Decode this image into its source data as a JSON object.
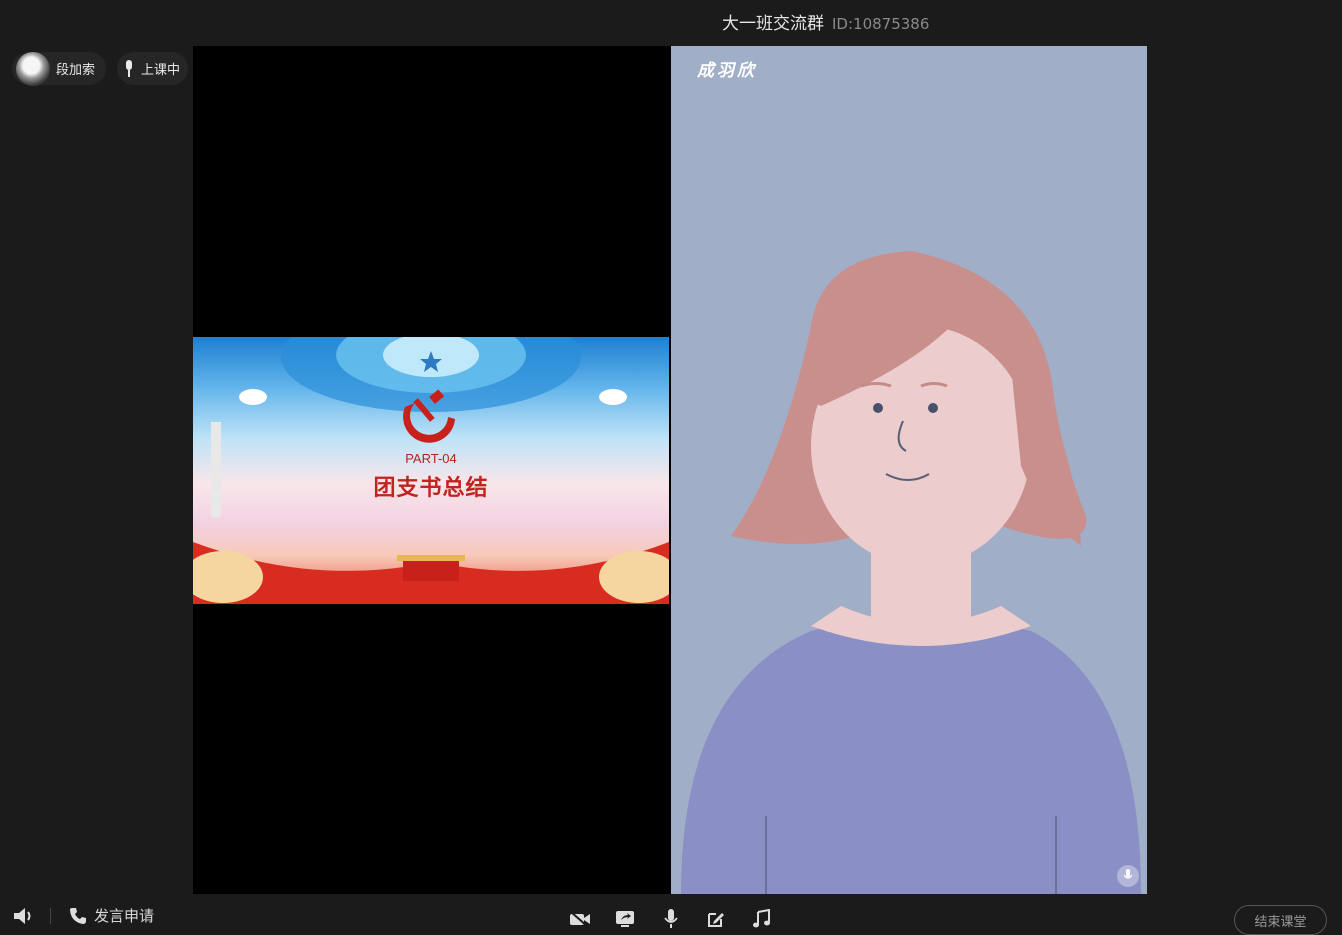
{
  "header": {
    "group_name": "大一班交流群",
    "group_id": "ID:10875386"
  },
  "teacher": {
    "name": "段加索",
    "status": "上课中"
  },
  "slide": {
    "part": "PART-04",
    "title": "团支书总结"
  },
  "speaker": {
    "name": "成羽欣"
  },
  "bottombar": {
    "request_label": "发言申请",
    "end_class_label": "结束课堂",
    "tools": [
      "camera-off-icon",
      "share-screen-icon",
      "microphone-icon",
      "edit-icon",
      "music-icon"
    ]
  },
  "colors": {
    "background": "#1b1b1b",
    "stage_left": "#000000",
    "stage_right": "#a0aec8",
    "accent_red": "#c0241f"
  }
}
